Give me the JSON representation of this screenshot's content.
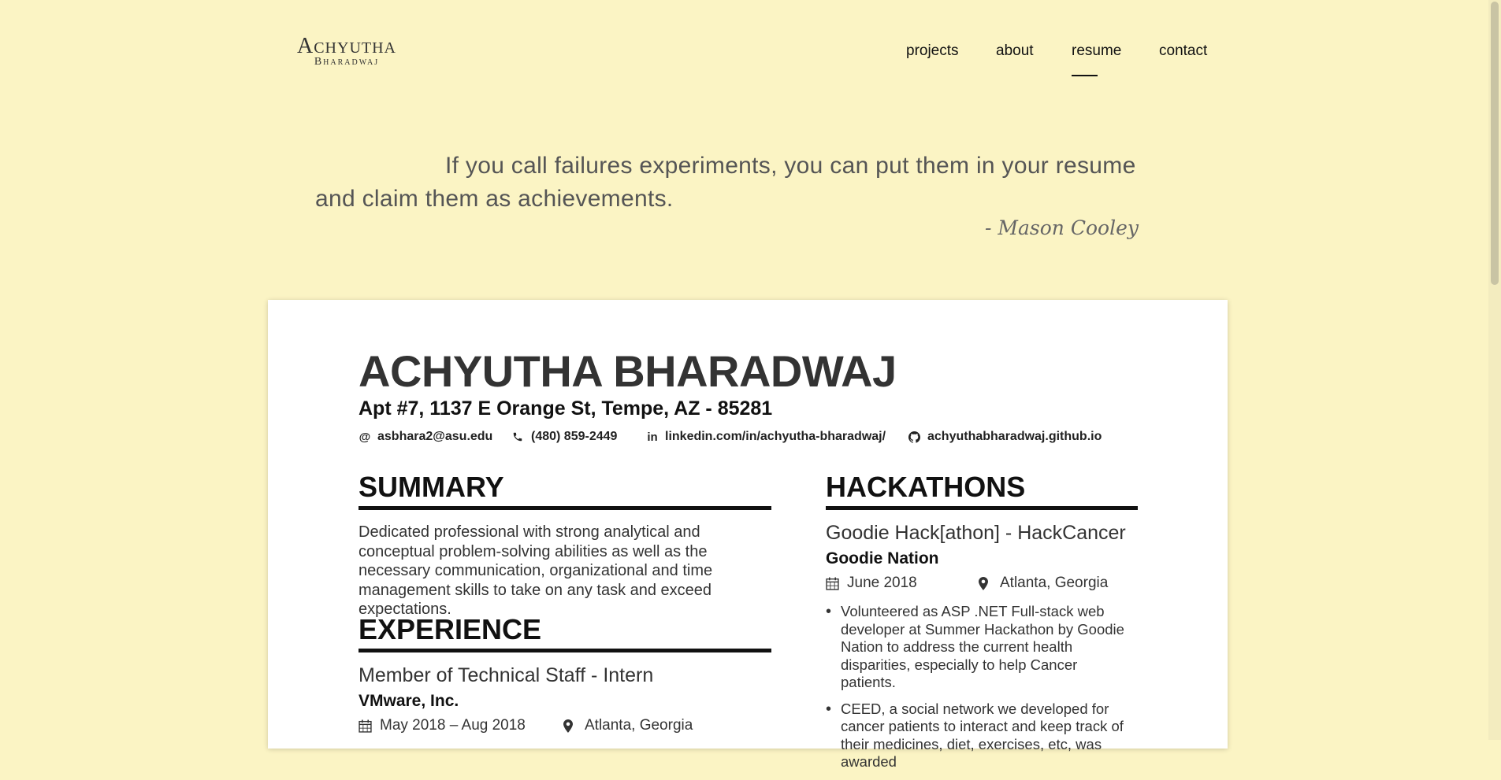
{
  "site": {
    "logo_top": "Achyutha",
    "logo_bottom": "Bharadwaj",
    "nav": [
      {
        "label": "projects"
      },
      {
        "label": "about"
      },
      {
        "label": "resume",
        "active": true
      },
      {
        "label": "contact"
      }
    ]
  },
  "quote": {
    "text": "If you call failures experiments, you can put them in your resume and claim them as achievements.",
    "author": "- Mason Cooley"
  },
  "resume": {
    "name": "ACHYUTHA BHARADWAJ",
    "address": "Apt #7, 1137 E Orange St, Tempe, AZ - 85281",
    "contacts": {
      "email": {
        "icon": "at-icon",
        "text": "asbhara2@asu.edu"
      },
      "phone": {
        "icon": "phone-icon",
        "text": "(480) 859-2449"
      },
      "linkedin": {
        "icon": "linkedin-icon",
        "text": "linkedin.com/in/achyutha-bharadwaj/"
      },
      "github": {
        "icon": "github-icon",
        "text": "achyuthabharadwaj.github.io"
      }
    },
    "summary": {
      "title": "SUMMARY",
      "text": "Dedicated professional with strong analytical and conceptual problem-solving abilities as well as the necessary communication, organizational and time management skills to take on any task and exceed expectations."
    },
    "experience": {
      "title": "EXPERIENCE",
      "item": {
        "role": "Member of Technical Staff - Intern",
        "org": "VMware, Inc.",
        "dates": "May 2018 – Aug 2018",
        "location": "Atlanta, Georgia"
      }
    },
    "hackathons": {
      "title": "HACKATHONS",
      "item": {
        "name": "Goodie Hack[athon] - HackCancer",
        "org": "Goodie Nation",
        "dates": "June 2018",
        "location": "Atlanta, Georgia",
        "bullets": [
          "Volunteered as ASP .NET Full-stack web developer at Summer Hackathon by Goodie Nation to address the current health disparities, especially to help Cancer patients.",
          "CEED, a social network we developed for cancer patients to interact and keep track of their medicines, diet, exercises, etc, was awarded"
        ]
      }
    }
  },
  "colors": {
    "page_background": "#fbf4c4",
    "card_background": "#ffffff",
    "text_dark": "#111111"
  }
}
